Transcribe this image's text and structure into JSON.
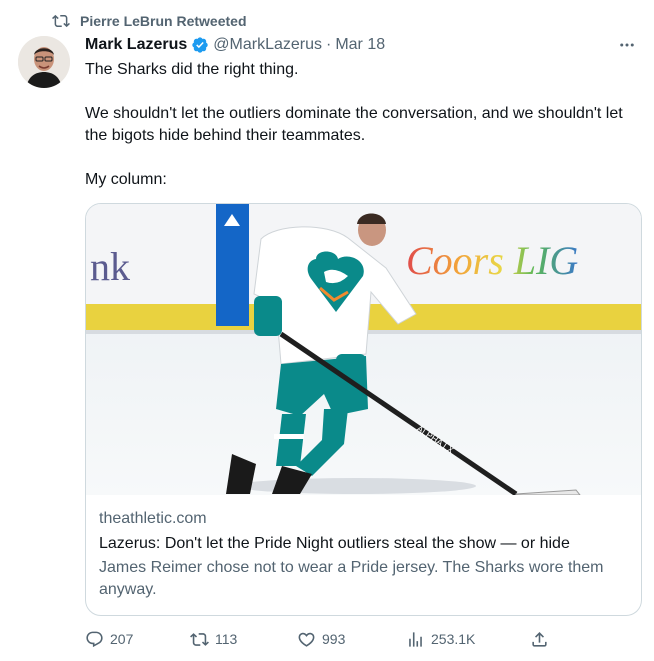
{
  "retweet_banner": {
    "text": "Pierre LeBrun Retweeted"
  },
  "tweet": {
    "author_name": "Mark Lazerus",
    "handle": "@MarkLazerus",
    "separator": "·",
    "date": "Mar 18",
    "lines": [
      "The Sharks did the right thing.",
      "We shouldn't let the outliers dominate the conversation, and we shouldn't let the bigots hide behind their teammates.",
      "My column:"
    ]
  },
  "card": {
    "domain": "theathletic.com",
    "title": "Lazerus: Don't let the Pride Night outliers steal the show — or hide",
    "description": "James Reimer chose not to wear a Pride jersey. The Sharks wore them anyway.",
    "image_text": {
      "arena_partial": "nk",
      "sponsor": "Coors LIG",
      "stick": "ALPHA LX"
    }
  },
  "actions": {
    "replies": "207",
    "retweets": "113",
    "likes": "993",
    "views": "253.1K"
  },
  "icons": {
    "retweet": "retweet-icon",
    "verified": "verified-badge-icon",
    "more": "more-options-icon",
    "reply": "reply-icon",
    "like": "heart-icon",
    "views": "bar-chart-icon",
    "share": "share-icon"
  },
  "colors": {
    "verified": "#1d9bf0",
    "muted": "#536471",
    "teal": "#0a8a8a"
  }
}
